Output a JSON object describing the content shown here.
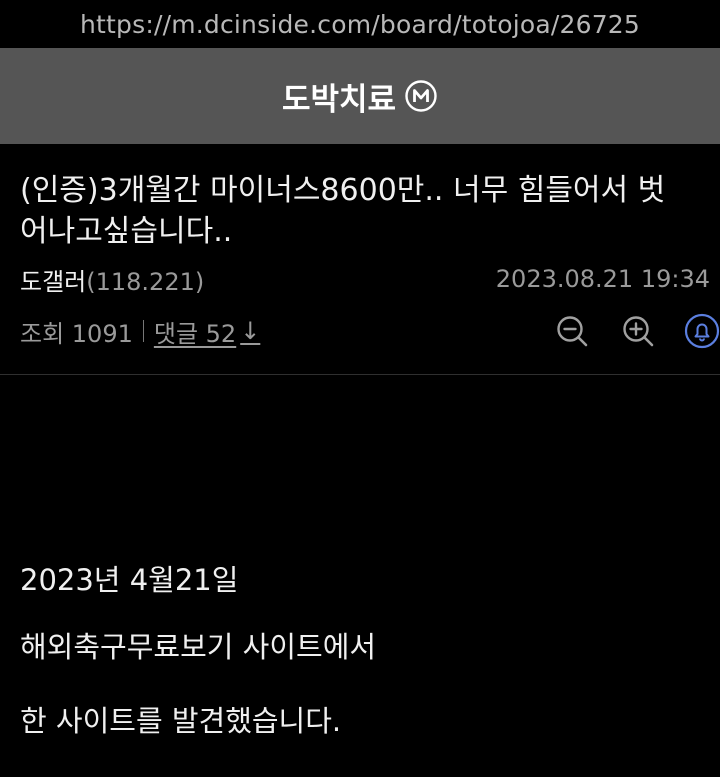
{
  "browser": {
    "url": "https://m.dcinside.com/board/totojoa/26725"
  },
  "gallery": {
    "name": "도박치료",
    "badge_icon": "minor-gallery-m-icon"
  },
  "post": {
    "title": "(인증)3개월간 마이너스8600만.. 너무 힘들어서 벗어나고싶습니다..",
    "author": "도갤러",
    "author_ip": "(118.221)",
    "date": "2023.08.21 19:34",
    "views_label": "조회 1091",
    "comments_label": "댓글 52",
    "comments_arrow": "↓",
    "icons": [
      "zoom-out-icon",
      "zoom-in-icon",
      "bell-icon"
    ],
    "body_lines": [
      "2023년 4월21일",
      "해외축구무료보기 사이트에서",
      "한 사이트를 발견했습니다."
    ]
  },
  "colors": {
    "header_bg": "#555555",
    "accent": "#5b7fe0",
    "muted": "#9a9a9a"
  }
}
